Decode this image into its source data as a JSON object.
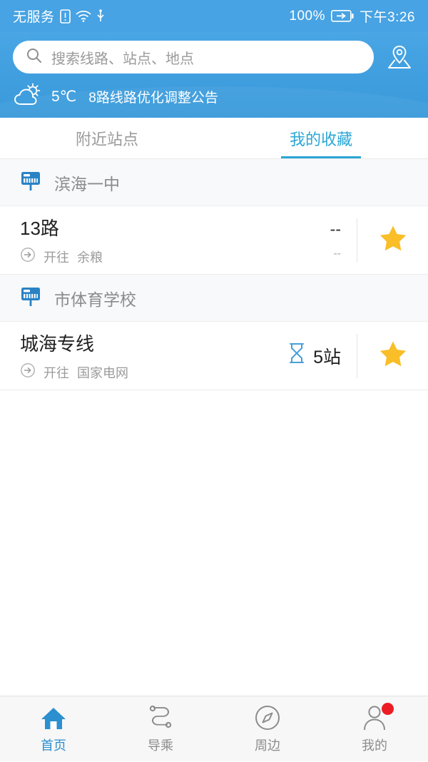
{
  "statusbar": {
    "carrier": "无服务",
    "battery_pct": "100%",
    "time": "下午3:26",
    "icons": [
      "sim-alert-icon",
      "wifi-icon",
      "usb-icon",
      "battery-charging-icon"
    ]
  },
  "header": {
    "search": {
      "placeholder": "搜索线路、站点、地点",
      "value": ""
    },
    "location_icon": "map-pin-icon",
    "weather": {
      "icon": "partly-cloudy-icon",
      "temperature": "5℃"
    },
    "notice": "8路线路优化调整公告",
    "accent_color": "#3f9ede"
  },
  "tabs": {
    "items": [
      {
        "label": "附近站点",
        "active": false
      },
      {
        "label": "我的收藏",
        "active": true
      }
    ],
    "active_color": "#2ba6d6"
  },
  "groups": [
    {
      "station": "滨海一中",
      "station_icon": "bus-stop-sign-icon",
      "routes": [
        {
          "name": "13路",
          "direction_prefix": "开往",
          "direction": "余粮",
          "direction_icon": "arrow-circle-right-icon",
          "status": "--",
          "status_icon": "",
          "status_sub": "--",
          "favorited": true,
          "favorite_icon": "star-filled-icon"
        }
      ]
    },
    {
      "station": "市体育学校",
      "station_icon": "bus-stop-sign-icon",
      "routes": [
        {
          "name": "城海专线",
          "direction_prefix": "开往",
          "direction": "国家电网",
          "direction_icon": "arrow-circle-right-icon",
          "status": "5站",
          "status_icon": "hourglass-icon",
          "status_sub": "",
          "favorited": true,
          "favorite_icon": "star-filled-icon"
        }
      ]
    }
  ],
  "tabbar": {
    "items": [
      {
        "label": "首页",
        "icon": "home-icon",
        "active": true,
        "badge": false
      },
      {
        "label": "导乘",
        "icon": "route-path-icon",
        "active": false,
        "badge": false
      },
      {
        "label": "周边",
        "icon": "compass-icon",
        "active": false,
        "badge": false
      },
      {
        "label": "我的",
        "icon": "person-icon",
        "active": false,
        "badge": true
      }
    ],
    "active_color": "#2b8fd0",
    "badge_color": "#ec1c24"
  },
  "colors": {
    "star": "#f9be28",
    "hourglass": "#4a9fd8",
    "station_icon": "#2a82c4"
  }
}
